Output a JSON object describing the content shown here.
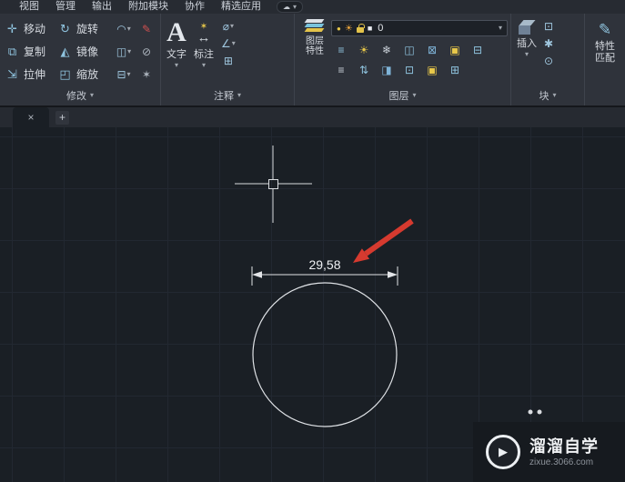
{
  "menubar": {
    "items": [
      "视图",
      "管理",
      "输出",
      "附加模块",
      "协作",
      "精选应用"
    ]
  },
  "ribbon": {
    "modify": {
      "title": "修改",
      "move": "移动",
      "rotate": "旋转",
      "copy": "复制",
      "mirror": "镜像",
      "stretch": "拉伸",
      "scale": "缩放"
    },
    "annotate": {
      "title": "注释",
      "text": "文字",
      "dimension": "标注"
    },
    "layers": {
      "title": "图层",
      "props_line1": "图层",
      "props_line2": "特性",
      "current": "0",
      "row1": [
        "≡",
        "☀",
        "❄",
        "◫",
        "⊠",
        "▣",
        "⊟"
      ],
      "row2": [
        "≡",
        "⇅",
        "◨",
        "⊡",
        "▣",
        "⊞"
      ]
    },
    "block": {
      "title": "块",
      "insert": "插入"
    },
    "match": {
      "line1": "特性",
      "line2": "匹配"
    }
  },
  "drawing": {
    "dimension_text": "29,58"
  },
  "watermark": {
    "brand": "溜溜自学",
    "site": "zixue.3066.com"
  },
  "icons": {
    "chevron": "▾",
    "cloud": "☁",
    "close": "×",
    "plus": "+",
    "move": "✛",
    "rotate": "↻",
    "copy": "⧉",
    "mirror": "◭",
    "stretch": "⇲",
    "scale": "◰",
    "fillet": "◠",
    "array": "◫",
    "trim": "⊟",
    "pencil": "✎",
    "erase": "⊘",
    "explode": "✶",
    "text": "A",
    "dim_star": "✶",
    "dim_arrows": "↔",
    "diameter": "⌀",
    "angle": "∠",
    "table": "⊞",
    "bulb": "●",
    "sun": "☀",
    "swatch": "■",
    "b1": "⊡",
    "b2": "✱",
    "b3": "⊙",
    "brush": "✎",
    "logo": "▶"
  }
}
